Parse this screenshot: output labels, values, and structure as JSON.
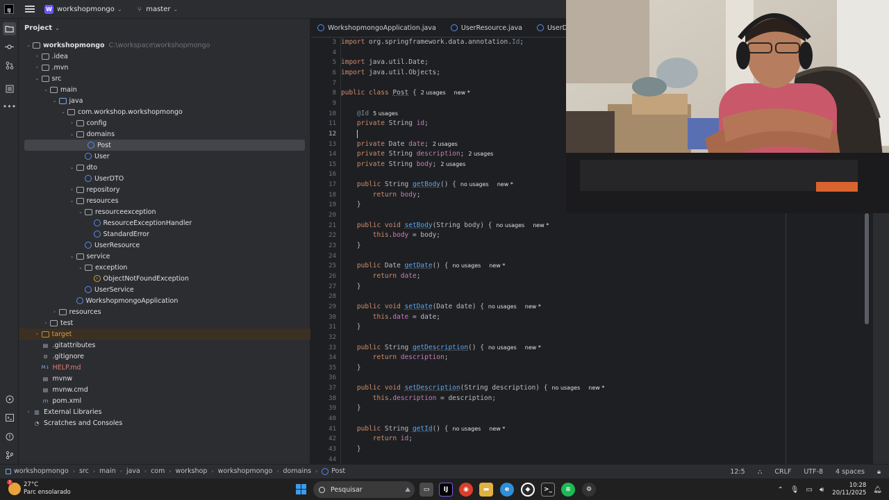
{
  "titlebar": {
    "logo": "IJ",
    "project_badge": "W",
    "project_name": "workshopmongo",
    "branch": "master"
  },
  "project_panel": {
    "title": "Project",
    "root_name": "workshopmongo",
    "root_path": "C:\\workspace\\workshopmongo",
    "tree": [
      {
        "label": "workshopmongo",
        "depth": 0,
        "arrow": "open",
        "icon": "folder"
      },
      {
        "label": ".idea",
        "depth": 1,
        "arrow": "closed",
        "icon": "folder"
      },
      {
        "label": ".mvn",
        "depth": 1,
        "arrow": "closed",
        "icon": "folder"
      },
      {
        "label": "src",
        "depth": 1,
        "arrow": "open",
        "icon": "folder"
      },
      {
        "label": "main",
        "depth": 2,
        "arrow": "open",
        "icon": "folder"
      },
      {
        "label": "java",
        "depth": 3,
        "arrow": "open",
        "icon": "folder-blue"
      },
      {
        "label": "com.workshop.workshopmongo",
        "depth": 4,
        "arrow": "open",
        "icon": "folder"
      },
      {
        "label": "config",
        "depth": 5,
        "arrow": "closed",
        "icon": "folder"
      },
      {
        "label": "domains",
        "depth": 5,
        "arrow": "open",
        "icon": "folder"
      },
      {
        "label": "Post",
        "depth": 6,
        "arrow": "",
        "icon": "class",
        "selected": true
      },
      {
        "label": "User",
        "depth": 6,
        "arrow": "",
        "icon": "class"
      },
      {
        "label": "dto",
        "depth": 5,
        "arrow": "open",
        "icon": "folder"
      },
      {
        "label": "UserDTO",
        "depth": 6,
        "arrow": "",
        "icon": "class"
      },
      {
        "label": "repository",
        "depth": 5,
        "arrow": "closed",
        "icon": "folder"
      },
      {
        "label": "resources",
        "depth": 5,
        "arrow": "open",
        "icon": "folder"
      },
      {
        "label": "resourceexception",
        "depth": 6,
        "arrow": "open",
        "icon": "folder"
      },
      {
        "label": "ResourceExceptionHandler",
        "depth": 7,
        "arrow": "",
        "icon": "class"
      },
      {
        "label": "StandardError",
        "depth": 7,
        "arrow": "",
        "icon": "class"
      },
      {
        "label": "UserResource",
        "depth": 6,
        "arrow": "",
        "icon": "class"
      },
      {
        "label": "service",
        "depth": 5,
        "arrow": "open",
        "icon": "folder"
      },
      {
        "label": "exception",
        "depth": 6,
        "arrow": "open",
        "icon": "folder"
      },
      {
        "label": "ObjectNotFoundException",
        "depth": 7,
        "arrow": "",
        "icon": "exception"
      },
      {
        "label": "UserService",
        "depth": 6,
        "arrow": "",
        "icon": "class"
      },
      {
        "label": "WorkshopmongoApplication",
        "depth": 5,
        "arrow": "",
        "icon": "class"
      },
      {
        "label": "resources",
        "depth": 3,
        "arrow": "closed",
        "icon": "folder"
      },
      {
        "label": "test",
        "depth": 2,
        "arrow": "closed",
        "icon": "folder"
      },
      {
        "label": "target",
        "depth": 1,
        "arrow": "closed",
        "icon": "folder-orange",
        "style": "orange"
      },
      {
        "label": ".gitattributes",
        "depth": 1,
        "arrow": "",
        "icon": "file"
      },
      {
        "label": ".gitignore",
        "depth": 1,
        "arrow": "",
        "icon": "file-circle"
      },
      {
        "label": "HELP.md",
        "depth": 1,
        "arrow": "",
        "icon": "md",
        "style": "red"
      },
      {
        "label": "mvnw",
        "depth": 1,
        "arrow": "",
        "icon": "file"
      },
      {
        "label": "mvnw.cmd",
        "depth": 1,
        "arrow": "",
        "icon": "file"
      },
      {
        "label": "pom.xml",
        "depth": 1,
        "arrow": "",
        "icon": "maven"
      },
      {
        "label": "External Libraries",
        "depth": 0,
        "arrow": "closed",
        "icon": "lib"
      },
      {
        "label": "Scratches and Consoles",
        "depth": 0,
        "arrow": "",
        "icon": "scratch"
      }
    ]
  },
  "tabs": [
    {
      "label": "WorkshopmongoApplication.java"
    },
    {
      "label": "UserResource.java"
    },
    {
      "label": "UserDTO.ja"
    }
  ],
  "editor": {
    "lines": [
      {
        "n": "3",
        "segs": [
          [
            "kw",
            "import "
          ],
          [
            "pkg",
            "org.springframework.data.annotation."
          ],
          [
            "ann",
            "Id"
          ],
          [
            "pkg",
            ";"
          ]
        ]
      },
      {
        "n": "4",
        "segs": []
      },
      {
        "n": "5",
        "segs": [
          [
            "kw",
            "import "
          ],
          [
            "pkg",
            "java.util.Date;"
          ]
        ]
      },
      {
        "n": "6",
        "segs": [
          [
            "kw",
            "import "
          ],
          [
            "pkg",
            "java.util.Objects;"
          ]
        ]
      },
      {
        "n": "7",
        "segs": []
      },
      {
        "n": "8",
        "segs": [
          [
            "kw",
            "public class "
          ],
          [
            "cls",
            "Post"
          ],
          [
            "typ",
            " {"
          ],
          [
            "hint",
            "2 usages"
          ],
          [
            "hint2",
            "new *"
          ]
        ]
      },
      {
        "n": "9",
        "segs": []
      },
      {
        "n": "10",
        "segs": [
          [
            "typ",
            "    "
          ],
          [
            "ann",
            "@Id"
          ],
          [
            "hint",
            "5 usages"
          ]
        ]
      },
      {
        "n": "11",
        "segs": [
          [
            "kw",
            "    private "
          ],
          [
            "typ",
            "String "
          ],
          [
            "fld",
            "id"
          ],
          [
            "typ",
            ";"
          ]
        ]
      },
      {
        "n": "12",
        "segs": [
          [
            "typ",
            "    "
          ],
          [
            "caret",
            ""
          ]
        ],
        "current": true
      },
      {
        "n": "13",
        "segs": [
          [
            "kw",
            "    private "
          ],
          [
            "typ",
            "Date "
          ],
          [
            "fld",
            "date"
          ],
          [
            "typ",
            ";"
          ],
          [
            "hint",
            "2 usages"
          ]
        ]
      },
      {
        "n": "14",
        "segs": [
          [
            "kw",
            "    private "
          ],
          [
            "typ",
            "String "
          ],
          [
            "fld",
            "description"
          ],
          [
            "typ",
            ";"
          ],
          [
            "hint",
            "2 usages"
          ]
        ]
      },
      {
        "n": "15",
        "segs": [
          [
            "kw",
            "    private "
          ],
          [
            "typ",
            "String "
          ],
          [
            "fld",
            "body"
          ],
          [
            "typ",
            ";"
          ],
          [
            "hint",
            "2 usages"
          ]
        ]
      },
      {
        "n": "16",
        "segs": []
      },
      {
        "n": "17",
        "segs": [
          [
            "kw",
            "    public "
          ],
          [
            "typ",
            "String "
          ],
          [
            "fn",
            "getBody"
          ],
          [
            "typ",
            "() {"
          ],
          [
            "hint",
            "no usages"
          ],
          [
            "hint2",
            "new *"
          ]
        ]
      },
      {
        "n": "18",
        "segs": [
          [
            "kw",
            "        return "
          ],
          [
            "fld",
            "body"
          ],
          [
            "typ",
            ";"
          ]
        ]
      },
      {
        "n": "19",
        "segs": [
          [
            "typ",
            "    }"
          ]
        ]
      },
      {
        "n": "20",
        "segs": []
      },
      {
        "n": "21",
        "segs": [
          [
            "kw",
            "    public void "
          ],
          [
            "fn",
            "setBody"
          ],
          [
            "typ",
            "(String body) {"
          ],
          [
            "hint",
            "no usages"
          ],
          [
            "hint2",
            "new *"
          ]
        ]
      },
      {
        "n": "22",
        "segs": [
          [
            "kw",
            "        this"
          ],
          [
            "typ",
            "."
          ],
          [
            "fld",
            "body"
          ],
          [
            "typ",
            " = body;"
          ]
        ]
      },
      {
        "n": "23",
        "segs": [
          [
            "typ",
            "    }"
          ]
        ]
      },
      {
        "n": "24",
        "segs": []
      },
      {
        "n": "25",
        "segs": [
          [
            "kw",
            "    public "
          ],
          [
            "typ",
            "Date "
          ],
          [
            "fn",
            "getDate"
          ],
          [
            "typ",
            "() {"
          ],
          [
            "hint",
            "no usages"
          ],
          [
            "hint2",
            "new *"
          ]
        ]
      },
      {
        "n": "26",
        "segs": [
          [
            "kw",
            "        return "
          ],
          [
            "fld",
            "date"
          ],
          [
            "typ",
            ";"
          ]
        ]
      },
      {
        "n": "27",
        "segs": [
          [
            "typ",
            "    }"
          ]
        ]
      },
      {
        "n": "28",
        "segs": []
      },
      {
        "n": "29",
        "segs": [
          [
            "kw",
            "    public void "
          ],
          [
            "fn",
            "setDate"
          ],
          [
            "typ",
            "(Date date) {"
          ],
          [
            "hint",
            "no usages"
          ],
          [
            "hint2",
            "new *"
          ]
        ]
      },
      {
        "n": "30",
        "segs": [
          [
            "kw",
            "        this"
          ],
          [
            "typ",
            "."
          ],
          [
            "fld",
            "date"
          ],
          [
            "typ",
            " = date;"
          ]
        ]
      },
      {
        "n": "31",
        "segs": [
          [
            "typ",
            "    }"
          ]
        ]
      },
      {
        "n": "32",
        "segs": []
      },
      {
        "n": "33",
        "segs": [
          [
            "kw",
            "    public "
          ],
          [
            "typ",
            "String "
          ],
          [
            "fn",
            "getDescription"
          ],
          [
            "typ",
            "() {"
          ],
          [
            "hint",
            "no usages"
          ],
          [
            "hint2",
            "new *"
          ]
        ]
      },
      {
        "n": "34",
        "segs": [
          [
            "kw",
            "        return "
          ],
          [
            "fld",
            "description"
          ],
          [
            "typ",
            ";"
          ]
        ]
      },
      {
        "n": "35",
        "segs": [
          [
            "typ",
            "    }"
          ]
        ]
      },
      {
        "n": "36",
        "segs": []
      },
      {
        "n": "37",
        "segs": [
          [
            "kw",
            "    public void "
          ],
          [
            "fn",
            "setDescription"
          ],
          [
            "typ",
            "(String description) {"
          ],
          [
            "hint",
            "no usages"
          ],
          [
            "hint2",
            "new *"
          ]
        ]
      },
      {
        "n": "38",
        "segs": [
          [
            "kw",
            "        this"
          ],
          [
            "typ",
            "."
          ],
          [
            "fld",
            "description"
          ],
          [
            "typ",
            " = description;"
          ]
        ]
      },
      {
        "n": "39",
        "segs": [
          [
            "typ",
            "    }"
          ]
        ]
      },
      {
        "n": "40",
        "segs": []
      },
      {
        "n": "41",
        "segs": [
          [
            "kw",
            "    public "
          ],
          [
            "typ",
            "String "
          ],
          [
            "fn",
            "getId"
          ],
          [
            "typ",
            "() {"
          ],
          [
            "hint",
            "no usages"
          ],
          [
            "hint2",
            "new *"
          ]
        ]
      },
      {
        "n": "42",
        "segs": [
          [
            "kw",
            "        return "
          ],
          [
            "fld",
            "id"
          ],
          [
            "typ",
            ";"
          ]
        ]
      },
      {
        "n": "43",
        "segs": [
          [
            "typ",
            "    }"
          ]
        ]
      },
      {
        "n": "44",
        "segs": []
      }
    ]
  },
  "statusbar": {
    "breadcrumbs": [
      "workshopmongo",
      "src",
      "main",
      "java",
      "com",
      "workshop",
      "workshopmongo",
      "domains",
      "Post"
    ],
    "cursor": "12:5",
    "line_ending": "CRLF",
    "encoding": "UTF-8",
    "indent": "4 spaces"
  },
  "taskbar": {
    "weather_temp": "27°C",
    "weather_desc": "Parc ensolarado",
    "weather_badge": "3",
    "search_placeholder": "Pesquisar",
    "time": "10:28",
    "date": "20/11/2025"
  },
  "colors": {
    "accent": "#6b57ff",
    "keyword": "#cf8e6d",
    "field": "#c77dbb",
    "method": "#56a8f5",
    "background": "#1e1f22",
    "panel": "#2b2d30"
  }
}
